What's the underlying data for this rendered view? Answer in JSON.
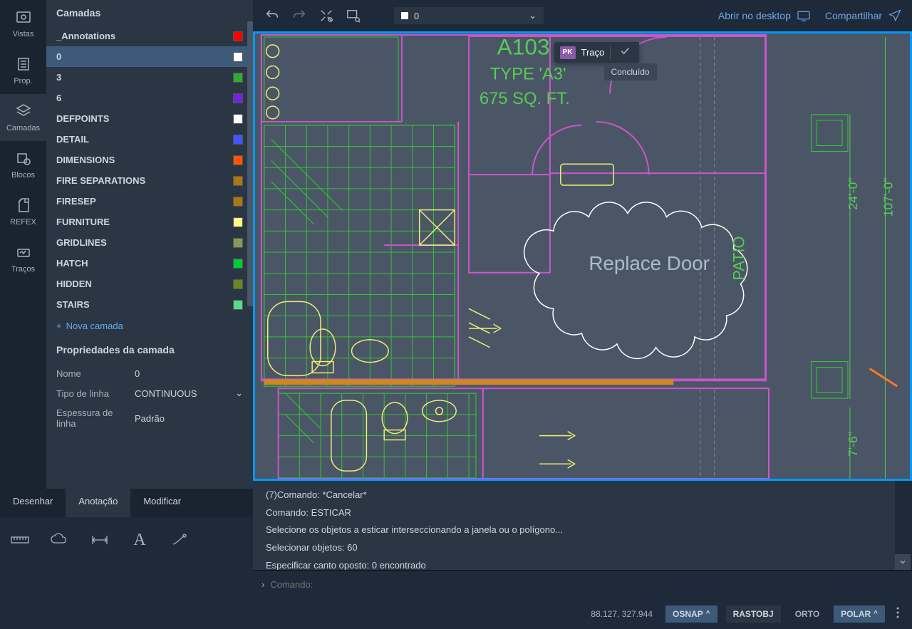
{
  "leftNav": [
    {
      "id": "vistas",
      "label": "Vistas"
    },
    {
      "id": "prop",
      "label": "Prop."
    },
    {
      "id": "camadas",
      "label": "Camadas",
      "active": true
    },
    {
      "id": "blocos",
      "label": "Blocos"
    },
    {
      "id": "refex",
      "label": "REFEX"
    },
    {
      "id": "tracos",
      "label": "Traços"
    }
  ],
  "layersPanel": {
    "title": "Camadas",
    "layers": [
      {
        "name": "_Annotations",
        "color": "#ff0000"
      },
      {
        "name": "0",
        "color": "#ffffff",
        "selected": true
      },
      {
        "name": "3",
        "color": "#33aa33"
      },
      {
        "name": "6",
        "color": "#7722dd"
      },
      {
        "name": "DEFPOINTS",
        "color": "#ffffff"
      },
      {
        "name": "DETAIL",
        "color": "#4455ff"
      },
      {
        "name": "DIMENSIONS",
        "color": "#ff5500"
      },
      {
        "name": "FIRE SEPARATIONS",
        "color": "#aa7711"
      },
      {
        "name": "FIRESEP",
        "color": "#aa7711"
      },
      {
        "name": "FURNITURE",
        "color": "#ffff88"
      },
      {
        "name": "GRIDLINES",
        "color": "#889955"
      },
      {
        "name": "HATCH",
        "color": "#00cc33"
      },
      {
        "name": "HIDDEN",
        "color": "#668822"
      },
      {
        "name": "STAIRS",
        "color": "#55dd88"
      }
    ],
    "newLayer": "Nova camada",
    "propsTitle": "Propriedades da camada",
    "nameLabel": "Nome",
    "nameValue": "0",
    "linetypeLabel": "Tipo de linha",
    "linetypeValue": "CONTINUOUS",
    "lineweightLabel": "Espessura de linha",
    "lineweightValue": "Padrão"
  },
  "topToolbar": {
    "layerDropdown": {
      "label": "0",
      "color": "#ffffff"
    },
    "openDesktop": "Abrir no desktop",
    "share": "Compartilhar"
  },
  "trace": {
    "avatar": "PK",
    "label": "Traço",
    "tooltip": "Concluído"
  },
  "canvas": {
    "title1": "A103",
    "title2": "TYPE 'A3'",
    "title3": "675 SQ. FT.",
    "annotation": "Replace Door",
    "patio": "PATIO",
    "dim1": "24'-0\"",
    "dim2": "107'-0\"",
    "dim3": "7'-6\""
  },
  "bottomTabs": {
    "draw": "Desenhar",
    "annotate": "Anotação",
    "modify": "Modificar",
    "active": "annotate"
  },
  "commandHistory": [
    "(7)Comando: *Cancelar*",
    "Comando: ESTICAR",
    "Selecione os objetos a esticar interseccionando a janela ou o polígono...",
    "Selecionar objetos: 60",
    "Especificar canto oposto: 0 encontrado"
  ],
  "commandInput": {
    "placeholder": "Comando:"
  },
  "statusBar": {
    "coords": "88.127, 327.944",
    "osnap": "OSNAP",
    "rastobj": "RASTOBJ",
    "orto": "ORTO",
    "polar": "POLAR"
  }
}
